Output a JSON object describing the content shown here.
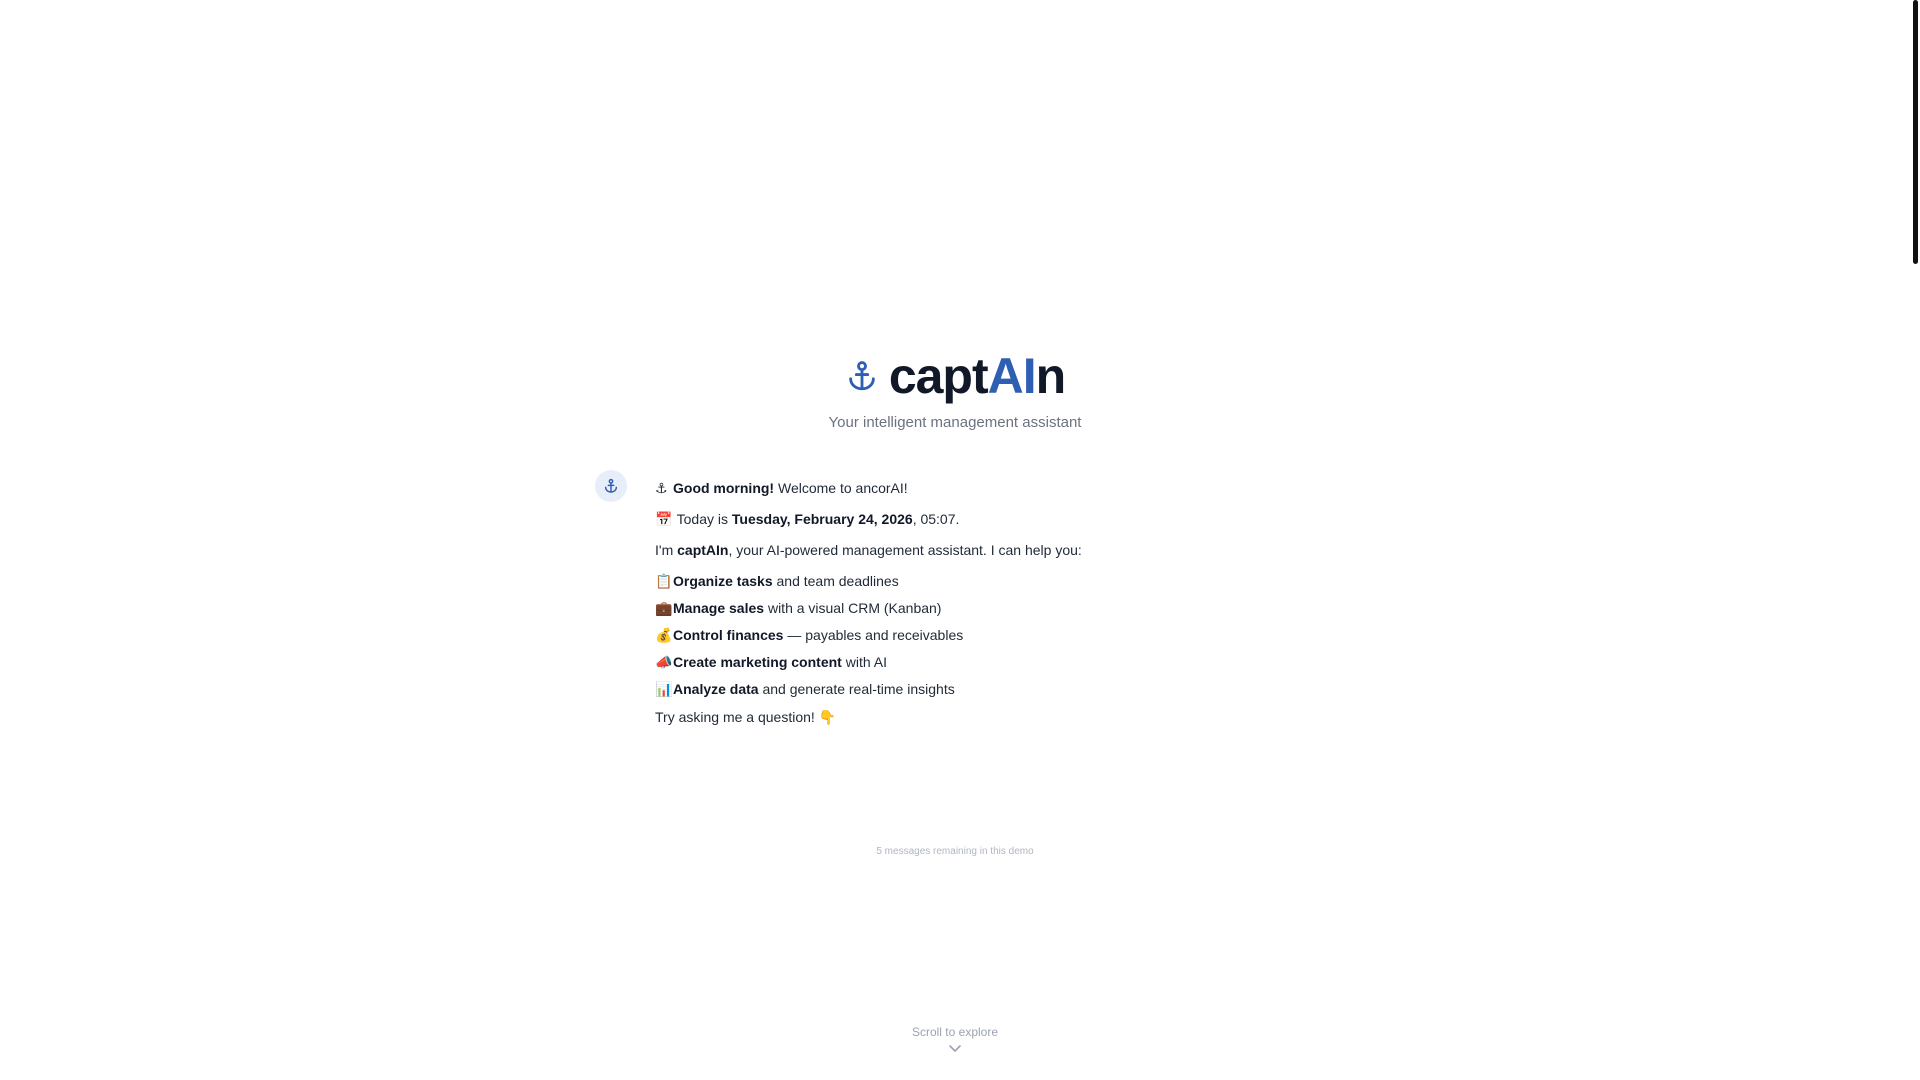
{
  "header": {
    "title_prefix": "capt",
    "title_highlight": "AI",
    "title_suffix": "n",
    "subtitle": "Your intelligent management assistant",
    "icon": "anchor-icon",
    "accent_color": "#2f5fb3"
  },
  "message": {
    "avatar_icon": "anchor-icon",
    "greeting": {
      "emoji": "⚓",
      "bold": "Good morning!",
      "text": " Welcome to ancorAI!"
    },
    "date_line": {
      "emoji": "📅",
      "text_before": " Today is ",
      "bold": "Tuesday, February 24, 2026",
      "text_after": ", 05:07."
    },
    "intro": {
      "text_before": "I'm ",
      "bold": "captAIn",
      "text_after": ", your AI-powered management assistant. I can help you:"
    },
    "features": [
      {
        "emoji": "📋",
        "bold": "Organize tasks",
        "text": " and team deadlines"
      },
      {
        "emoji": "💼",
        "bold": "Manage sales",
        "text": " with a visual CRM (Kanban)"
      },
      {
        "emoji": "💰",
        "bold": "Control finances",
        "text": " — payables and receivables"
      },
      {
        "emoji": "📣",
        "bold": "Create marketing content",
        "text": " with AI"
      },
      {
        "emoji": "📊",
        "bold": "Analyze data",
        "text": " and generate real-time insights"
      }
    ],
    "closing": {
      "text": "Try asking me a question! ",
      "emoji": "👇"
    }
  },
  "footer": {
    "remaining": "5 messages remaining in this demo",
    "scroll_hint": "Scroll to explore",
    "scroll_icon": "chevron-down-icon"
  }
}
